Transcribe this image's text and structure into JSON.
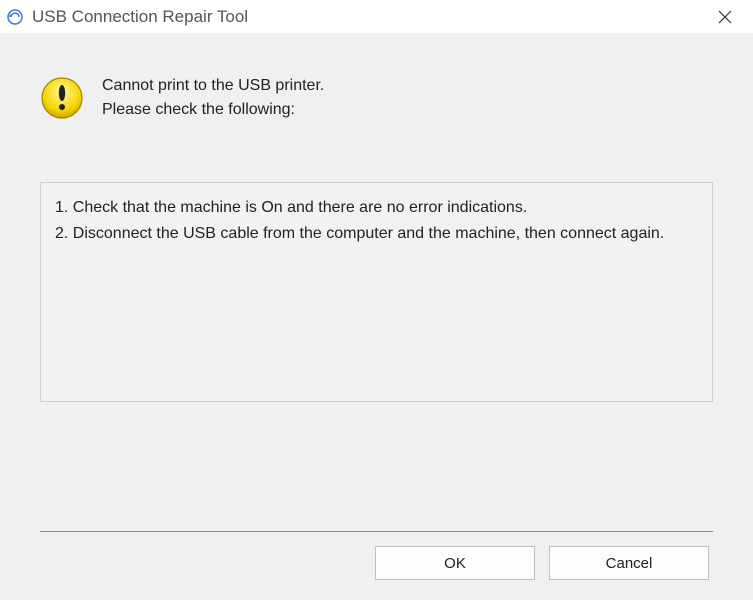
{
  "window": {
    "title": "USB Connection Repair Tool"
  },
  "message": {
    "line1": "Cannot print to the USB printer.",
    "line2": "Please check the following:"
  },
  "instructions": {
    "item1": "1. Check that the machine is On and there are no error indications.",
    "item2": "2. Disconnect the USB cable from the computer and the machine, then connect again."
  },
  "buttons": {
    "ok": "OK",
    "cancel": "Cancel"
  }
}
